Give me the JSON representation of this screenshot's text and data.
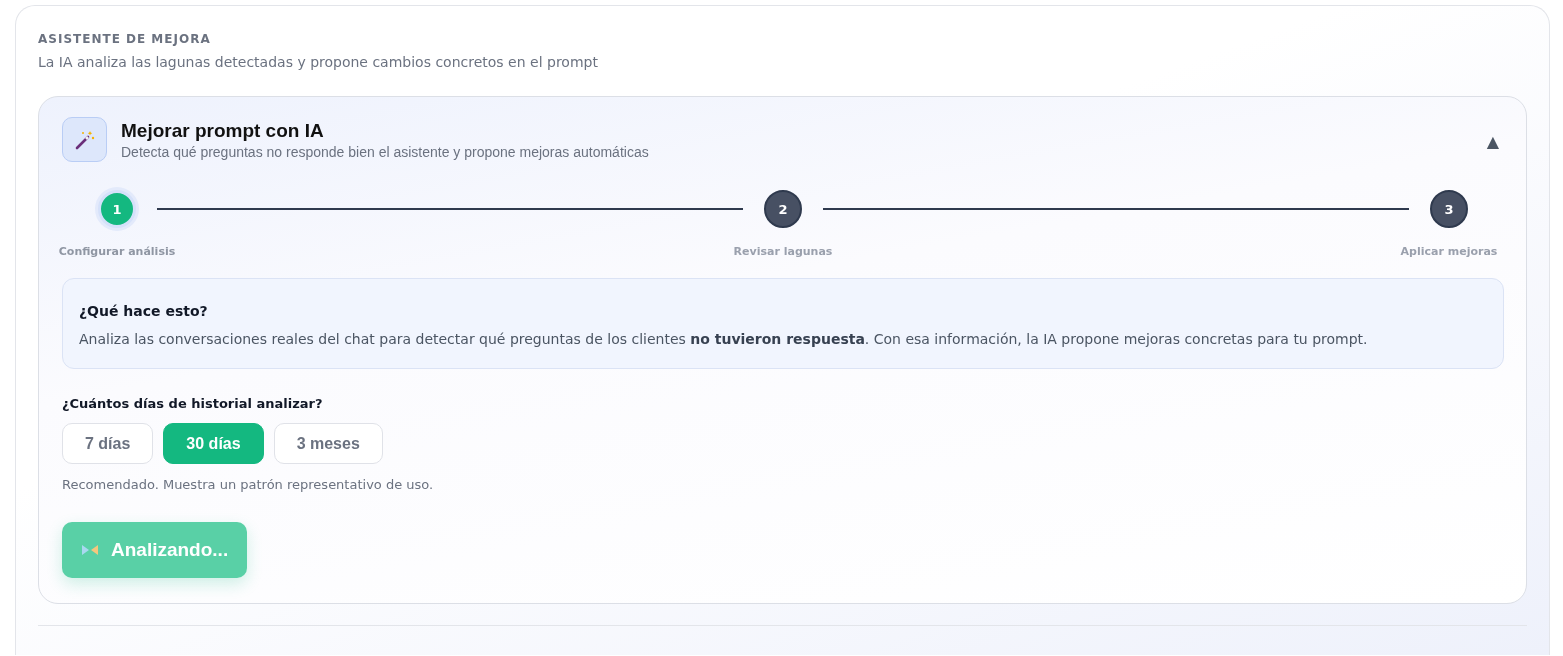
{
  "section": {
    "title": "ASISTENTE DE MEJORA",
    "subtitle": "La IA analiza las lagunas detectadas y propone cambios concretos en el prompt"
  },
  "panel": {
    "title": "Mejorar prompt con IA",
    "subtitle": "Detecta qué preguntas no responde bien el asistente y propone mejoras automáticas",
    "expanded": true,
    "toggle": "▲",
    "steps": [
      {
        "number": "1",
        "label": "Configurar análisis",
        "current": true
      },
      {
        "number": "2",
        "label": "Revisar lagunas",
        "current": false
      },
      {
        "number": "3",
        "label": "Aplicar mejoras",
        "current": false
      }
    ],
    "info": {
      "title": "¿Qué hace esto?",
      "text": "Analiza las conversaciones reales del chat para detectar qué preguntas de los clientes **no tuvieron respuesta**. Con esa información, la IA propone mejoras concretas para tu prompt."
    },
    "question": "¿Cuántos días de historial analizar?",
    "options": [
      {
        "label": "7 días",
        "selected": false
      },
      {
        "label": "30 días",
        "selected": true
      },
      {
        "label": "3 meses",
        "selected": false
      }
    ],
    "hint": "Recomendado. Muestra un patrón representativo de uso.",
    "action": {
      "label": "Analizando...",
      "loading": true
    }
  }
}
